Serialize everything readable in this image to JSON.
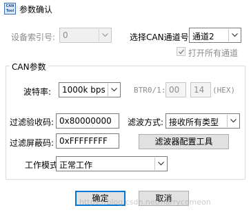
{
  "window": {
    "title": "参数确认",
    "icon_text_top": "CAN",
    "icon_text_bottom": "Tool"
  },
  "device_index": {
    "label": "设备索引号:",
    "value": "0",
    "enabled": false
  },
  "can_channel": {
    "label": "选择CAN通道号:",
    "value": "通道2"
  },
  "open_all_channels": {
    "label": "打开所有通道",
    "checked": true,
    "enabled": false
  },
  "can_params": {
    "group_label": "CAN参数",
    "baud_label": "波特率:",
    "baud_value": "1000k bps",
    "btr_label": "BTR0/1:",
    "btr0_value": "00",
    "btr1_value": "14",
    "btr_suffix": "(HEX)",
    "acc_code_label": "过滤验收码:",
    "acc_code_value": "0x80000000",
    "filter_mode_label": "滤波方式:",
    "filter_mode_value": "接收所有类型",
    "mask_label": "过滤屏蔽码:",
    "mask_value": "0xFFFFFFFF",
    "filter_tool_label": "滤波器配置工具",
    "work_mode_label": "工作模式",
    "work_mode_value": "正常工作"
  },
  "buttons": {
    "ok": "确定",
    "cancel": "取消"
  },
  "watermark": "https://blog.csdn.net/harrycomeon"
}
